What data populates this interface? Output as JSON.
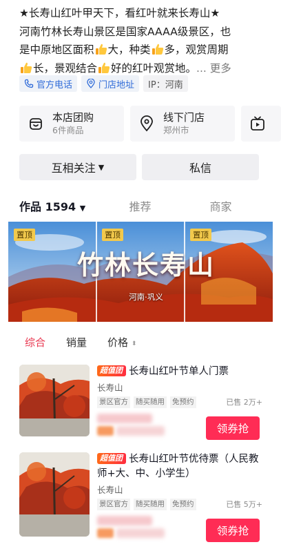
{
  "profile": {
    "bio_line1": "★长寿山红叶甲天下，看红叶就来长寿山★",
    "bio_line2": "河南竹林长寿山景区是国家AAAA级景区，也",
    "bio_line3a": "是中原地区面积",
    "bio_line3b": "大，种类",
    "bio_line3c": "多，观赏周期",
    "bio_line4a": "长，景观结合",
    "bio_line4b": "好的红叶观赏地。",
    "bio_ellipsis": "...",
    "bio_more": "更多",
    "chips": {
      "phone": "官方电话",
      "address": "门店地址",
      "ip": "IP：河南"
    }
  },
  "services": {
    "group_buy_title": "本店团购",
    "group_buy_sub": "6件商品",
    "store_title": "线下门店",
    "store_sub": "郑州市"
  },
  "actions": {
    "follow": "互相关注",
    "message": "私信"
  },
  "tabs": {
    "works": "作品 1594",
    "recommend": "推荐",
    "shop": "商家"
  },
  "banner": {
    "pin": "置顶",
    "title": "竹林长寿山",
    "subtitle": "河南·巩义"
  },
  "sort": {
    "general": "综合",
    "sales": "销量",
    "price": "价格"
  },
  "products": [
    {
      "badge": "超值团",
      "name": "长寿山红叶节单人门票",
      "shop": "长寿山",
      "tags": [
        "景区官方",
        "随买随用",
        "免预约"
      ],
      "sold": "已售 2万+",
      "button": "领券抢"
    },
    {
      "badge": "超值团",
      "name": "长寿山红叶节优待票（人民教师+大、中、小学生）",
      "shop": "长寿山",
      "tags": [
        "景区官方",
        "随买随用",
        "免预约"
      ],
      "sold": "已售 5万+",
      "button": "领券抢"
    }
  ],
  "colors": {
    "accent": "#ff2c55",
    "link": "#2f6bd8",
    "active_sort": "#e8364f"
  }
}
